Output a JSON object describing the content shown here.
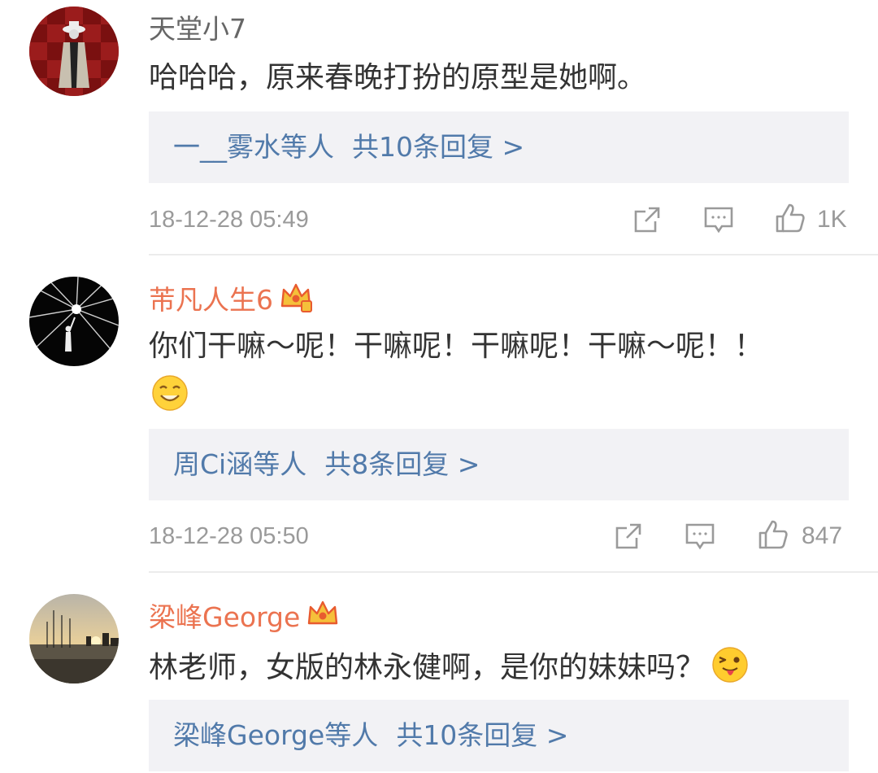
{
  "comments": [
    {
      "username": "天堂小7",
      "text": "哈哈哈，原来春晚打扮的原型是她啊。",
      "reply_names": "一__雾水等人",
      "reply_count": "共10条回复 >",
      "time": "18-12-28 05:49",
      "likes": "1K"
    },
    {
      "username": "芾凡人生6",
      "text": "你们干嘛～呢！干嘛呢！干嘛呢！干嘛～呢！！",
      "reply_names": "周Ci涵等人",
      "reply_count": "共8条回复 >",
      "time": "18-12-28 05:50",
      "likes": "847"
    },
    {
      "username": "梁峰George",
      "text": "林老师，女版的林永健啊，是你的妹妹吗？",
      "reply_names": "梁峰George等人",
      "reply_count": "共10条回复 >"
    }
  ],
  "colors": {
    "vip_name": "#eb7350",
    "link": "#517aaa",
    "meta": "#9a9a9a",
    "reply_bg": "#f2f2f5"
  },
  "icons": [
    "share-icon",
    "comment-icon",
    "like-icon",
    "vip-crown-icon",
    "smile-emoji",
    "tongue-emoji"
  ]
}
